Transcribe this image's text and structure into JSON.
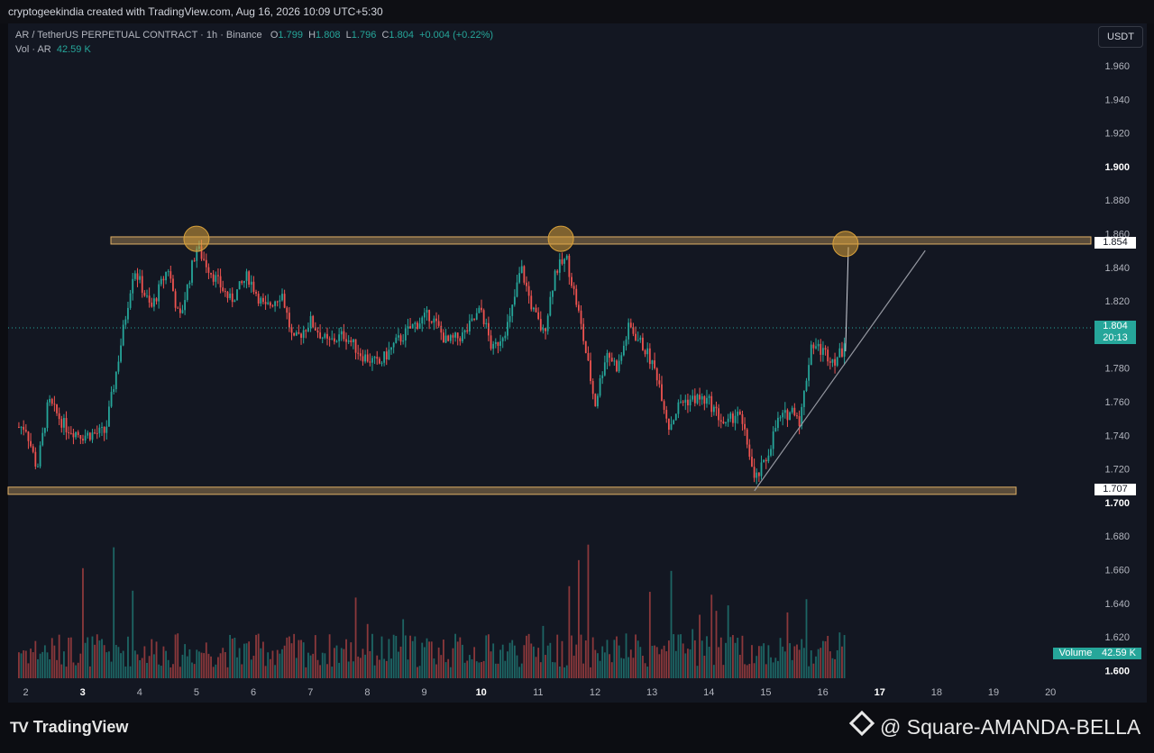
{
  "header": {
    "credit": "cryptogeekindia created with TradingView.com, Aug 16, 2026 10:09 UTC+5:30"
  },
  "legend": {
    "symbol": "AR / TetherUS PERPETUAL CONTRACT · 1h · Binance",
    "o_label": "O",
    "o": "1.799",
    "h_label": "H",
    "h": "1.808",
    "l_label": "L",
    "l": "1.796",
    "c_label": "C",
    "c": "1.804",
    "change": "+0.004 (+0.22%)",
    "vol_label": "Vol · AR",
    "vol": "42.59 K"
  },
  "currency_button": "USDT",
  "price_tags": {
    "resistance": "1.854",
    "last_price": "1.804",
    "countdown": "20:13",
    "support": "1.707",
    "volume_label": "Volume",
    "volume_value": "42.59 K"
  },
  "footer": {
    "logo": "TradingView",
    "watermark": "@ Square-AMANDA-BELLA"
  },
  "colors": {
    "up": "#26a69a",
    "down": "#ef5350",
    "level_band": "#e0b066",
    "background": "#131722"
  },
  "chart_data": {
    "type": "candlestick",
    "title": "AR / TetherUS PERPETUAL CONTRACT · 1h · Binance",
    "x_ticks": [
      "2",
      "3",
      "4",
      "5",
      "6",
      "7",
      "8",
      "9",
      "10",
      "11",
      "12",
      "13",
      "14",
      "15",
      "16",
      "17",
      "18",
      "19",
      "20"
    ],
    "y_ticks": [
      "1.960",
      "1.940",
      "1.920",
      "1.900",
      "1.880",
      "1.860",
      "1.840",
      "1.820",
      "1.800",
      "1.780",
      "1.760",
      "1.740",
      "1.720",
      "1.700",
      "1.680",
      "1.660",
      "1.640",
      "1.620",
      "1.600"
    ],
    "ylim": [
      1.594,
      1.978
    ],
    "xlim": [
      1.85,
      20.4
    ],
    "horizontal_levels": [
      1.856,
      1.707
    ],
    "last_price": 1.804,
    "trendline": {
      "from": [
        14.8,
        1.707
      ],
      "to": [
        17.8,
        1.85
      ]
    },
    "highlight_circles": [
      [
        5.0,
        1.857
      ],
      [
        11.4,
        1.857
      ],
      [
        16.4,
        1.854
      ]
    ],
    "price_path": [
      [
        2.0,
        1.745
      ],
      [
        2.2,
        1.72
      ],
      [
        2.4,
        1.76
      ],
      [
        2.7,
        1.745
      ],
      [
        3.0,
        1.74
      ],
      [
        3.4,
        1.742
      ],
      [
        3.6,
        1.78
      ],
      [
        3.9,
        1.84
      ],
      [
        4.2,
        1.815
      ],
      [
        4.5,
        1.84
      ],
      [
        4.7,
        1.808
      ],
      [
        5.0,
        1.852
      ],
      [
        5.3,
        1.835
      ],
      [
        5.6,
        1.82
      ],
      [
        5.9,
        1.835
      ],
      [
        6.2,
        1.815
      ],
      [
        6.5,
        1.825
      ],
      [
        6.7,
        1.795
      ],
      [
        7.0,
        1.808
      ],
      [
        7.3,
        1.795
      ],
      [
        7.6,
        1.8
      ],
      [
        7.9,
        1.788
      ],
      [
        8.2,
        1.782
      ],
      [
        8.5,
        1.795
      ],
      [
        8.8,
        1.805
      ],
      [
        9.1,
        1.812
      ],
      [
        9.4,
        1.795
      ],
      [
        9.7,
        1.8
      ],
      [
        10.0,
        1.815
      ],
      [
        10.2,
        1.79
      ],
      [
        10.5,
        1.808
      ],
      [
        10.7,
        1.84
      ],
      [
        10.9,
        1.815
      ],
      [
        11.1,
        1.8
      ],
      [
        11.3,
        1.838
      ],
      [
        11.5,
        1.845
      ],
      [
        11.7,
        1.815
      ],
      [
        11.9,
        1.778
      ],
      [
        12.0,
        1.758
      ],
      [
        12.2,
        1.79
      ],
      [
        12.4,
        1.78
      ],
      [
        12.6,
        1.805
      ],
      [
        12.9,
        1.79
      ],
      [
        13.1,
        1.775
      ],
      [
        13.3,
        1.745
      ],
      [
        13.5,
        1.76
      ],
      [
        13.8,
        1.762
      ],
      [
        14.0,
        1.76
      ],
      [
        14.3,
        1.745
      ],
      [
        14.5,
        1.755
      ],
      [
        14.7,
        1.732
      ],
      [
        14.8,
        1.712
      ],
      [
        15.0,
        1.725
      ],
      [
        15.2,
        1.748
      ],
      [
        15.5,
        1.756
      ],
      [
        15.6,
        1.748
      ],
      [
        15.8,
        1.795
      ],
      [
        16.0,
        1.79
      ],
      [
        16.2,
        1.785
      ],
      [
        16.35,
        1.79
      ],
      [
        16.4,
        1.804
      ]
    ]
  }
}
